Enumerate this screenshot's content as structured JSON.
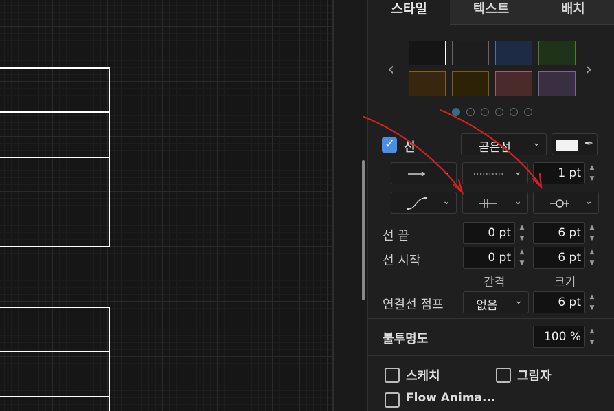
{
  "tabs": [
    "스타일",
    "텍스트",
    "배치"
  ],
  "swatches": [
    {
      "fill": "#151515",
      "border": "#ffffff",
      "icon": "swatch-dark-selected"
    },
    {
      "fill": "#1d1d1d",
      "border": "#666666",
      "icon": "swatch-dark"
    },
    {
      "fill": "#1d2c44",
      "border": "#4f6f98",
      "icon": "swatch-blue"
    },
    {
      "fill": "#1e3317",
      "border": "#4d7a3b",
      "icon": "swatch-green"
    },
    {
      "fill": "#38260f",
      "border": "#8b5e1e",
      "icon": "swatch-orange"
    },
    {
      "fill": "#2d2106",
      "border": "#7a5c12",
      "icon": "swatch-yellow"
    },
    {
      "fill": "#4a2a2a",
      "border": "#a85b5b",
      "icon": "swatch-red"
    },
    {
      "fill": "#3a2e42",
      "border": "#7d6494",
      "icon": "swatch-purple"
    }
  ],
  "line": {
    "label": "선",
    "checked": true,
    "pattern": "곧은선",
    "width": "1 pt"
  },
  "line_end": {
    "label": "선 끝",
    "spacing": "0 pt",
    "size": "6 pt"
  },
  "line_start": {
    "label": "선 시작",
    "spacing": "0 pt",
    "size": "6 pt"
  },
  "column_headers": {
    "spacing": "간격",
    "size": "크기"
  },
  "connector_jump": {
    "label": "연결선 점프",
    "value": "없음",
    "size": "6 pt"
  },
  "opacity": {
    "label": "불투명도",
    "value": "100 %"
  },
  "options": {
    "sketch": "스케치",
    "shadow": "그림자",
    "flow": "Flow Anima..."
  },
  "colors": {
    "accent": "#4a8ee6",
    "annotation": "#d42020"
  }
}
